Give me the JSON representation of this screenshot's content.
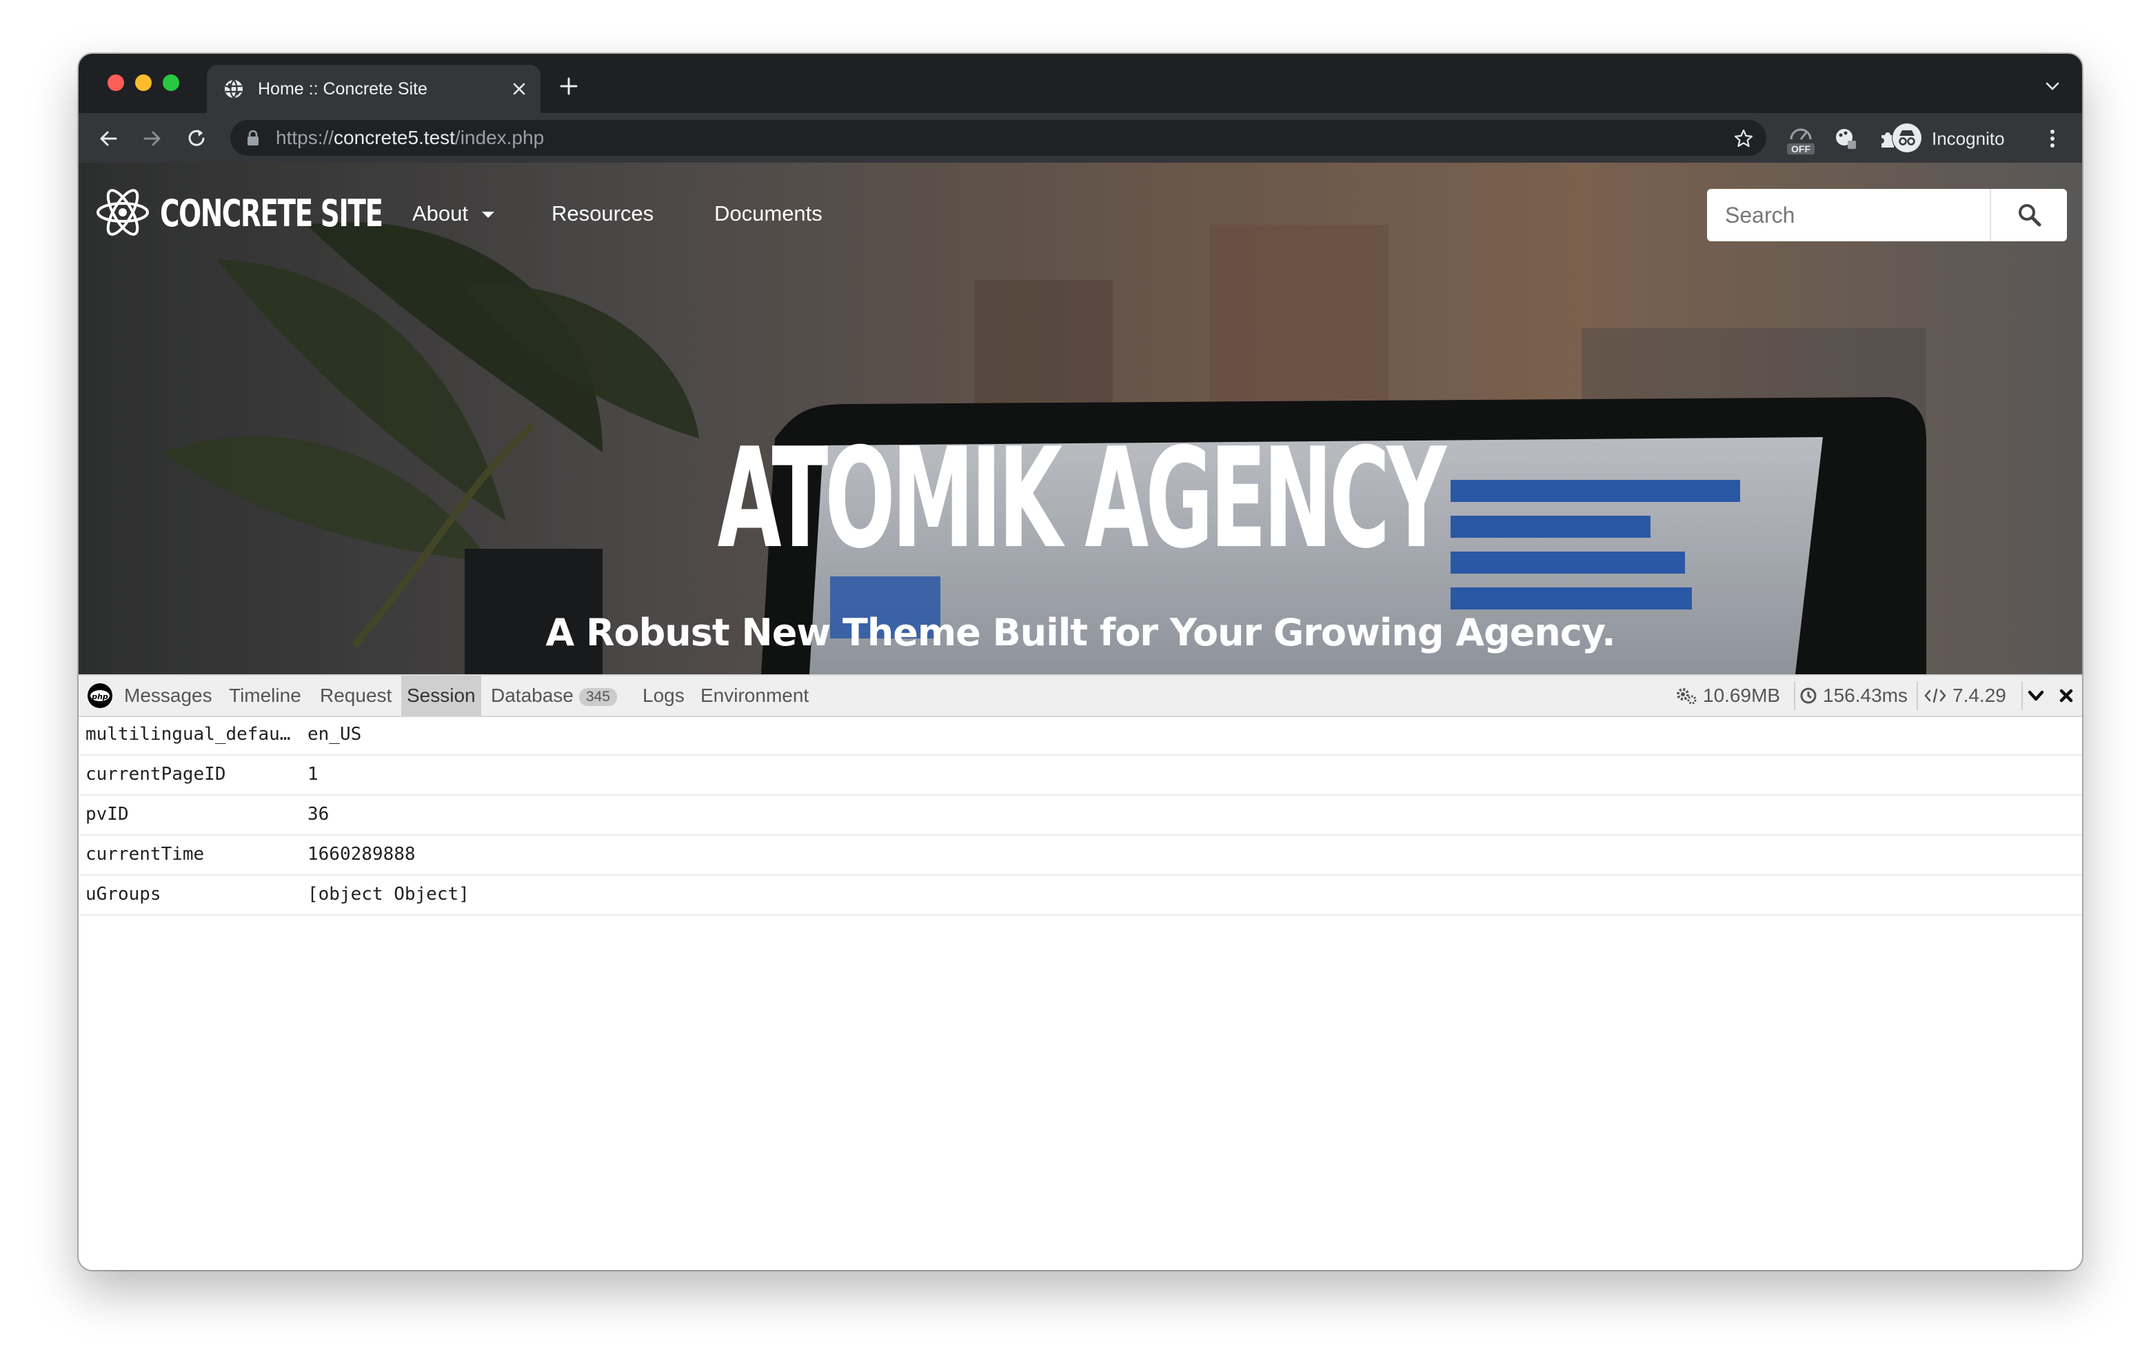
{
  "browser": {
    "tab_title": "Home :: Concrete Site",
    "url_scheme": "https://",
    "url_host": "concrete5.test",
    "url_path": "/index.php",
    "incognito_label": "Incognito",
    "extension_badge": "OFF"
  },
  "site": {
    "brand_name": "CONCRETE SITE",
    "nav": [
      {
        "label": "About",
        "has_dropdown": true
      },
      {
        "label": "Resources",
        "has_dropdown": false
      },
      {
        "label": "Documents",
        "has_dropdown": false
      }
    ],
    "search_placeholder": "Search",
    "hero_title": "ATOMIK AGENCY",
    "hero_subtitle": "A Robust New Theme Built for Your Growing Agency."
  },
  "debugbar": {
    "tabs": [
      {
        "label": "Messages"
      },
      {
        "label": "Timeline"
      },
      {
        "label": "Request"
      },
      {
        "label": "Session",
        "active": true
      },
      {
        "label": "Database",
        "badge": "345"
      },
      {
        "label": "Logs"
      },
      {
        "label": "Environment"
      }
    ],
    "memory": "10.69MB",
    "time": "156.43ms",
    "php_version": "7.4.29"
  },
  "session": {
    "rows": [
      {
        "key": "multilingual_defau…",
        "value": "en_US"
      },
      {
        "key": "currentPageID",
        "value": "1"
      },
      {
        "key": "pvID",
        "value": "36"
      },
      {
        "key": "currentTime",
        "value": "1660289888"
      },
      {
        "key": "uGroups",
        "value": "[object Object]"
      }
    ]
  },
  "colors": {
    "tabstrip": "#1f2023",
    "toolbar": "#35363a",
    "debug_bg": "#efefef",
    "debug_active": "#cfcfcf",
    "chart_bar": "#2f63b8"
  }
}
